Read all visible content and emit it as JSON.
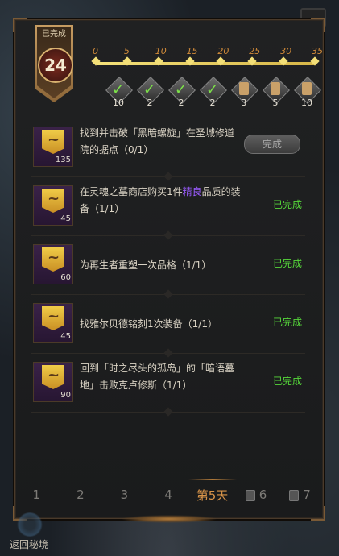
{
  "header": {
    "badge_status": "已完成",
    "level": "24",
    "ticks": [
      "0",
      "5",
      "10",
      "15",
      "20",
      "25",
      "30",
      "35"
    ],
    "progress_fraction": 1.0,
    "rewards": [
      {
        "icon": "check-icon",
        "count": "10"
      },
      {
        "icon": "check-icon",
        "count": "2"
      },
      {
        "icon": "check-icon",
        "count": "2"
      },
      {
        "icon": "check-icon",
        "count": "2"
      },
      {
        "icon": "scroll-icon",
        "count": "3"
      },
      {
        "icon": "scroll-icon",
        "count": "5"
      },
      {
        "icon": "scroll-icon",
        "count": "10"
      }
    ]
  },
  "tasks": [
    {
      "count": "135",
      "text": "找到并击破「黑暗螺旋」在圣城修道院的据点（0/1）",
      "status": "完成",
      "status_type": "button"
    },
    {
      "count": "45",
      "text_pre": "在灵魂之墓商店购买1件",
      "text_highlight": "精良",
      "text_post": "品质的装备（1/1）",
      "status": "已完成",
      "status_type": "done"
    },
    {
      "count": "60",
      "text": "为再生者重塑一次品格（1/1）",
      "status": "已完成",
      "status_type": "done"
    },
    {
      "count": "45",
      "text": "找雅尔贝德铭刻1次装备（1/1）",
      "status": "已完成",
      "status_type": "done"
    },
    {
      "count": "90",
      "text": "回到「时之尽头的孤岛」的「暗语墓地」击败克卢修斯（1/1）",
      "status": "已完成",
      "status_type": "done"
    }
  ],
  "tabs": [
    "1",
    "2",
    "3",
    "4",
    "第5天",
    "6",
    "7"
  ],
  "footer": {
    "left_label": "返回秘境"
  }
}
